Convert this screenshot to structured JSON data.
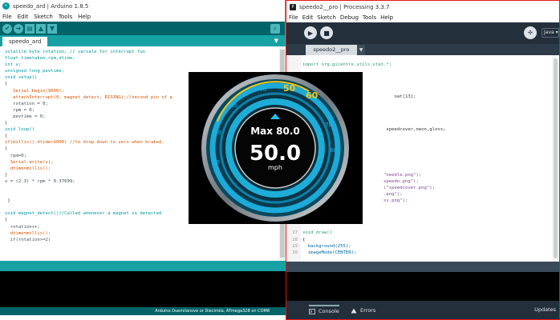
{
  "arduino": {
    "title": "speedo_ard | Arduino 1.8.5",
    "logo": "∞",
    "menu": [
      "File",
      "Edit",
      "Sketch",
      "Tools",
      "Help"
    ],
    "tab": "speedo_ard",
    "status": "Arduino Duemilanove or Diecimila, ATmega328 on COM8",
    "code": [
      "volatile byte rotation; // variale for interrupt fun",
      "float timetaken,rpm,dtime;",
      "int v;",
      "unsigned long pevtime;",
      "void setup()",
      "{",
      "   Serial.begin(9600);",
      "   attachInterrupt(0, magnet_detect, RISING);//second pin of a",
      "   rotation = 0;",
      "   rpm = 0;",
      "   pevtime = 0;",
      "}",
      "void loop()",
      "{",
      "if(millis()-dtime>1000) //to drop down to zero when braked.",
      "{",
      "  rpm=0;",
      "  Serial.write(v);",
      "  dtime=millis();",
      "}",
      "v = (2.3) * rpm * 0.37699;",
      "",
      "",
      " }",
      "",
      "void magnet_detect()//Called whenever a magnet is detected",
      "{",
      "  rotation++;",
      "  dtime=millis();",
      "  if(rotation>=2)"
    ]
  },
  "processing": {
    "title": "speedo2__pro | Processing 3.3.7",
    "menu": [
      "File",
      "Edit",
      "Sketch",
      "Debug",
      "Tools",
      "Help"
    ],
    "tab": "speedo2__pro",
    "mode": "Java ▾",
    "console_label": "Console",
    "errors_label": "Errors",
    "updates_label": "Updates",
    "code": [
      {
        "n": "",
        "t": "import org.gicentre.utils.stat.*;"
      },
      {
        "n": "",
        "t": ""
      },
      {
        "n": "",
        "t": ""
      },
      {
        "n": "",
        "t": ""
      },
      {
        "n": "",
        "t": ""
      },
      {
        "n": "",
        "t": "                                  oat[13];"
      },
      {
        "n": "",
        "t": ""
      },
      {
        "n": "",
        "t": ""
      },
      {
        "n": "",
        "t": ""
      },
      {
        "n": "",
        "t": ""
      },
      {
        "n": "",
        "t": "                               speedcover,neon,gloss;"
      },
      {
        "n": "",
        "t": ""
      },
      {
        "n": "",
        "t": ""
      },
      {
        "n": "",
        "t": ""
      },
      {
        "n": "",
        "t": ""
      },
      {
        "n": "",
        "t": ""
      },
      {
        "n": "",
        "t": ""
      },
      {
        "n": "",
        "t": "                              \"needle.png\");"
      },
      {
        "n": "",
        "t": "                              speedo.png\");"
      },
      {
        "n": "",
        "t": "                              (\"speedcover.png\");"
      },
      {
        "n": "",
        "t": "                              .png\");"
      },
      {
        "n": "",
        "t": "                              ss.png\");"
      },
      {
        "n": "",
        "t": ""
      },
      {
        "n": "",
        "t": ""
      },
      {
        "n": "",
        "t": ""
      },
      {
        "n": "",
        "t": ""
      },
      {
        "n": "27",
        "t": "void draw()"
      },
      {
        "n": "28",
        "t": "{"
      },
      {
        "n": "29",
        "t": "  background(255);"
      },
      {
        "n": "30",
        "t": "  imageMode(CENTER);"
      }
    ]
  },
  "speedo": {
    "max_label": "Max 80.0",
    "speed": "50.0",
    "unit": "mph",
    "marks": [
      "50",
      "60",
      "70",
      "80",
      "40",
      "30",
      "20",
      "10",
      "0"
    ],
    "colors": {
      "accent": "#19b3e6",
      "gold": "#f5c518"
    }
  }
}
